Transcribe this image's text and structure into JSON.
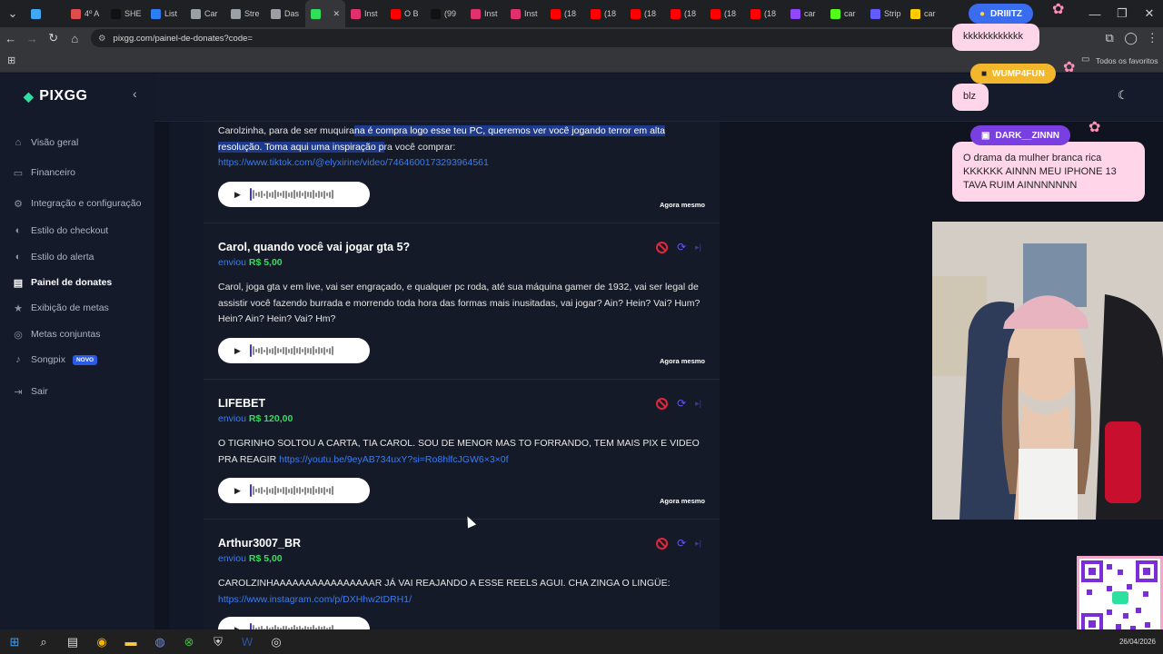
{
  "browser": {
    "tabs": [
      {
        "label": "",
        "color": "#3fa9f5"
      },
      {
        "label": "4º A",
        "color": "#e04b4b"
      },
      {
        "label": "SHE",
        "color": "#111111"
      },
      {
        "label": "List",
        "color": "#2d7df6"
      },
      {
        "label": "Car",
        "color": "#9aa0a6"
      },
      {
        "label": "Stre",
        "color": "#9aa0a6"
      },
      {
        "label": "Das",
        "color": "#9aa0a6"
      },
      {
        "label": "",
        "color": "#2fe05a"
      },
      {
        "label": "Inst",
        "color": "#e1306c"
      },
      {
        "label": "O B",
        "color": "#ff0000"
      },
      {
        "label": "(99",
        "color": "#111111"
      },
      {
        "label": "Inst",
        "color": "#e1306c"
      },
      {
        "label": "Inst",
        "color": "#e1306c"
      },
      {
        "label": "(18",
        "color": "#ff0000"
      },
      {
        "label": "(18",
        "color": "#ff0000"
      },
      {
        "label": "(18",
        "color": "#ff0000"
      },
      {
        "label": "(18",
        "color": "#ff0000"
      },
      {
        "label": "(18",
        "color": "#ff0000"
      },
      {
        "label": "(18",
        "color": "#ff0000"
      },
      {
        "label": "car",
        "color": "#9146ff"
      },
      {
        "label": "car",
        "color": "#53fc18"
      },
      {
        "label": "Strip",
        "color": "#635bff"
      },
      {
        "label": "car",
        "color": "#ffcc00"
      }
    ],
    "url": "pixgg.com/painel-de-donates?code=",
    "all_favorites": "Todos os favoritos"
  },
  "sidebar": {
    "brand": "PIXGG",
    "items": [
      {
        "label": "Visão geral",
        "icon": "home-icon"
      },
      {
        "label": "Financeiro",
        "icon": "wallet-icon"
      },
      {
        "label": "Integração e configuração",
        "icon": "settings-icon"
      },
      {
        "label": "Estilo do checkout",
        "icon": "palette-icon"
      },
      {
        "label": "Estilo do alerta",
        "icon": "palette-icon"
      },
      {
        "label": "Painel de donates",
        "icon": "chart-icon"
      },
      {
        "label": "Exibição de metas",
        "icon": "star-icon"
      },
      {
        "label": "Metas conjuntas",
        "icon": "target-icon"
      },
      {
        "label": "Songpix",
        "icon": "music-icon",
        "badge": "NOVO"
      },
      {
        "label": "Sair",
        "icon": "logout-icon"
      }
    ]
  },
  "donations": [
    {
      "title": "",
      "amount": "",
      "message_prefix": "Carolzinha, para de ser muquira",
      "message_highlight": "na é compra logo esse teu PC, queremos ver você jogando terror em alta resolução. Toma aqui uma inspiração p",
      "message_suffix": "ra você comprar:",
      "link": "https://www.tiktok.com/@elyxirine/video/7464600173293964561",
      "time": "Agora mesmo"
    },
    {
      "title": "Carol, quando você vai jogar gta 5?",
      "sent_label": "enviou",
      "amount": "R$ 5,00",
      "message": "Carol, joga gta v em live, vai ser engraçado, e qualquer pc roda, até sua máquina gamer de 1932, vai ser legal de assistir você fazendo burrada e morrendo toda hora das formas mais inusitadas, vai jogar? Ain? Hein? Vai? Hum? Hein? Ain? Hein? Vai? Hm?",
      "time": "Agora mesmo"
    },
    {
      "title": "LIFEBET",
      "sent_label": "enviou",
      "amount": "R$ 120,00",
      "message": "O TIGRINHO SOLTOU A CARTA, TIA CAROL. SOU DE MENOR MAS TO FORRANDO, TEM MAIS PIX E VIDEO PRA REAGIR ",
      "link": "https://youtu.be/9eyAB734uxY?si=Ro8hlfcJGW6×3×0f",
      "time": "Agora mesmo"
    },
    {
      "title": "Arthur3007_BR",
      "sent_label": "enviou",
      "amount": "R$ 5,00",
      "message": "CAROLZINHAAAAAAAAAAAAAAAAR JÁ VAI REAJANDO A ESSE REELS AGUI. CHA ZINGA O LINGÜE:",
      "link": "https://www.instagram.com/p/DXHhw2tDRH1/"
    }
  ],
  "chat": [
    {
      "user": "DRIIITZ",
      "text": "kkkkkkkkkkkk",
      "color": "#3a6cf0"
    },
    {
      "user": "WUMP4FUN",
      "text": "blz",
      "color": "#f2b72c"
    },
    {
      "user": "DARK__ZINNN",
      "text": "O drama da mulher branca rica KKKKKK AINNN MEU IPHONE 13 TAVA RUIM AINNNNNNN",
      "color": "#7a3fe0"
    }
  ],
  "taskbar": {
    "date": "26/04/2026",
    "apps": [
      "windows-icon",
      "search-icon",
      "taskview-icon",
      "chrome-icon",
      "explorer-icon",
      "discord-icon",
      "xbox-icon",
      "security-icon",
      "word-icon",
      "obs-icon"
    ]
  }
}
